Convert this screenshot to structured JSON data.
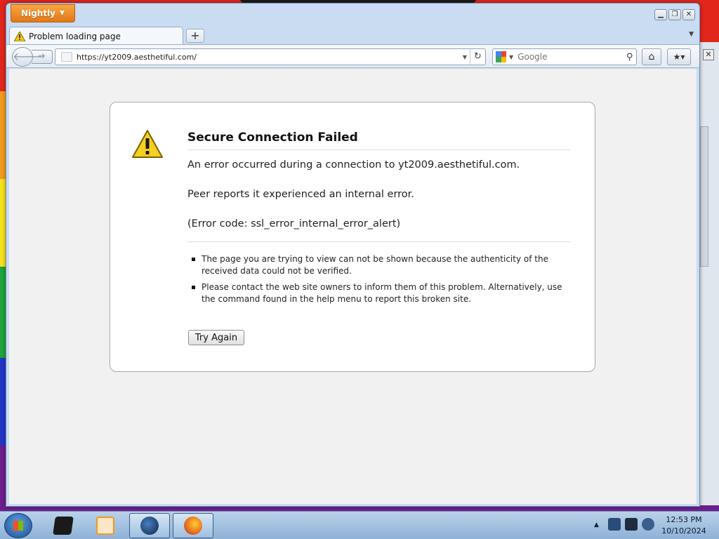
{
  "browser": {
    "menu_button": "Nightly",
    "tab_title": "Problem loading page",
    "new_tab": "+",
    "url": "https://yt2009.aesthetiful.com/",
    "search_placeholder": "Google",
    "window_controls": {
      "minimize": "▁",
      "restore": "❐",
      "close": "✕"
    }
  },
  "error_page": {
    "title": "Secure Connection Failed",
    "description": "An error occurred during a connection to yt2009.aesthetiful.com.",
    "peer_message": "Peer reports it experienced an internal error.",
    "error_code": "(Error code: ssl_error_internal_error_alert)",
    "bullets": [
      "The page you are trying to view can not be shown because the authenticity of the received data could not be verified.",
      "Please contact the web site owners to inform them of this problem. Alternatively, use the command found in the help menu to report this broken site."
    ],
    "try_again": "Try Again"
  },
  "taskbar": {
    "time": "12:53 PM",
    "date": "10/10/2024",
    "items": [
      {
        "name": "explorer",
        "icon": "folder-icon",
        "color": "#1a1a1a"
      },
      {
        "name": "media player",
        "icon": "media-player-icon",
        "color": "#f39a1c"
      },
      {
        "name": "browser globe",
        "icon": "globe-icon",
        "color": "#1b3f73"
      },
      {
        "name": "firefox",
        "icon": "firefox-icon",
        "color": "#e46b1c"
      }
    ]
  },
  "colors": {
    "accent_orange": "#e37818",
    "window_frame": "#c9dcf1",
    "taskbar": "#9ebfe0"
  }
}
